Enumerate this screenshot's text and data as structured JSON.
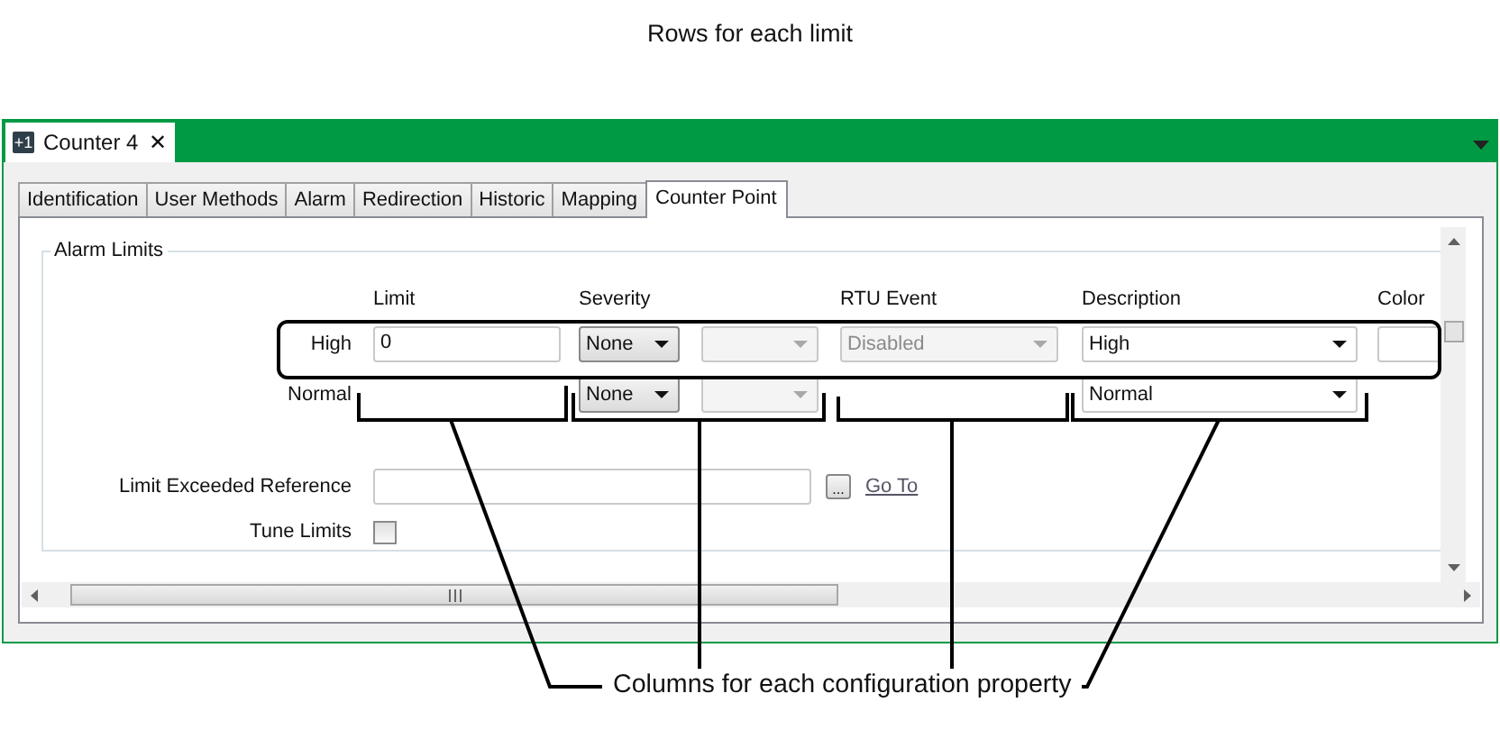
{
  "caption_top": "Rows for each limit",
  "window": {
    "title": "Counter 4",
    "icon_text": "+1",
    "close": "✕"
  },
  "tabs": [
    {
      "label": "Identification",
      "selected": false
    },
    {
      "label": "User Methods",
      "selected": false
    },
    {
      "label": "Alarm",
      "selected": false
    },
    {
      "label": "Redirection",
      "selected": false
    },
    {
      "label": "Historic",
      "selected": false
    },
    {
      "label": "Mapping",
      "selected": false
    },
    {
      "label": "Counter Point",
      "selected": true
    }
  ],
  "group": {
    "title": "Alarm Limits",
    "columns": [
      "",
      "Limit",
      "Severity",
      "",
      "RTU Event",
      "Description",
      "Color"
    ],
    "rows": [
      {
        "label": "High",
        "limit": "0",
        "severity": "None",
        "rtu_event": "Disabled",
        "description": "High",
        "color_field": true
      },
      {
        "label": "Normal",
        "severity": "None",
        "description": "Normal",
        "color_field": false
      }
    ],
    "reference": {
      "label": "Limit Exceeded Reference",
      "button": "...",
      "link": "Go To"
    },
    "tune_limits": {
      "label": "Tune Limits",
      "checked": false
    }
  },
  "caption_bottom": "Columns for each configuration property"
}
